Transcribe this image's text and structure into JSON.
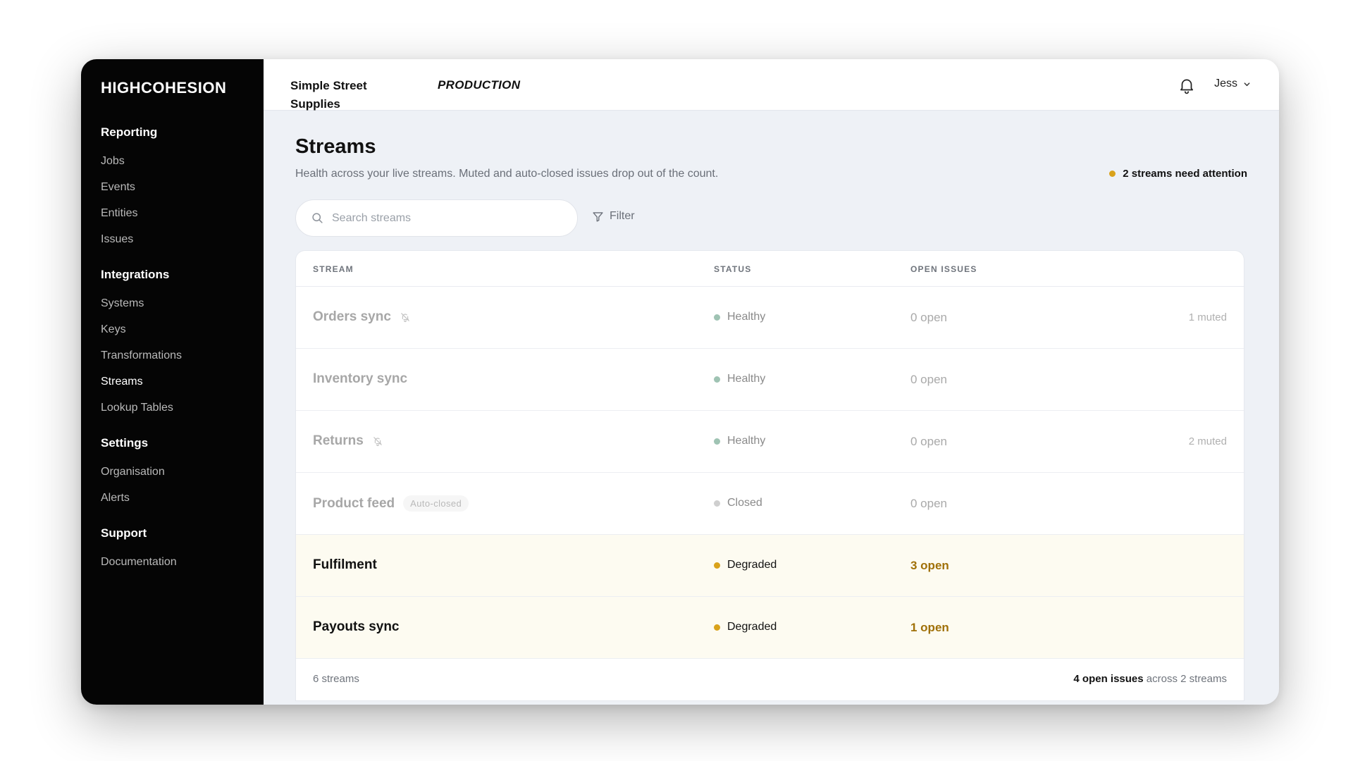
{
  "sidebar": {
    "logo": "HIGHCOHESION",
    "groups": [
      {
        "heading": "Reporting",
        "items": [
          "Jobs",
          "Events",
          "Entities",
          "Issues"
        ]
      },
      {
        "heading": "Integrations",
        "items": [
          "Systems",
          "Keys",
          "Transformations",
          "Streams",
          "Lookup Tables"
        ]
      },
      {
        "heading": "Settings",
        "items": [
          "Organisation",
          "Alerts"
        ]
      },
      {
        "heading": "Support",
        "items": [
          "Documentation"
        ]
      }
    ],
    "active_item": "Streams"
  },
  "topbar": {
    "org_name": "Simple Street Supplies",
    "environment": "PRODUCTION",
    "user_name": "Jess"
  },
  "page": {
    "title": "Streams",
    "subtitle": "Health across your live streams. Muted and auto-closed issues drop out of the count.",
    "attention": "2 streams need attention"
  },
  "search": {
    "placeholder": "Search streams"
  },
  "filter_label": "Filter",
  "table": {
    "columns": [
      "STREAM",
      "STATUS",
      "OPEN ISSUES"
    ],
    "rows": [
      {
        "name": "Orders sync",
        "muted_icon": true,
        "tag": "",
        "status": "Healthy",
        "issues": "0 open",
        "muted": "1 muted",
        "state": "healthy"
      },
      {
        "name": "Inventory sync",
        "muted_icon": false,
        "tag": "",
        "status": "Healthy",
        "issues": "0 open",
        "muted": "",
        "state": "healthy"
      },
      {
        "name": "Returns",
        "muted_icon": true,
        "tag": "",
        "status": "Healthy",
        "issues": "0 open",
        "muted": "2 muted",
        "state": "healthy"
      },
      {
        "name": "Product feed",
        "muted_icon": false,
        "tag": "Auto-closed",
        "status": "Closed",
        "issues": "0 open",
        "muted": "",
        "state": "closed"
      },
      {
        "name": "Fulfilment",
        "muted_icon": false,
        "tag": "",
        "status": "Degraded",
        "issues": "3 open",
        "muted": "",
        "state": "degraded"
      },
      {
        "name": "Payouts sync",
        "muted_icon": false,
        "tag": "",
        "status": "Degraded",
        "issues": "1 open",
        "muted": "",
        "state": "degraded"
      }
    ],
    "footer_count": "6 streams",
    "footer_summary_bold": "4 open issues",
    "footer_summary_rest": " across 2 streams"
  },
  "colors": {
    "sidebar_bg": "#050505",
    "degraded": "#d9a21b",
    "healthy": "#9fc3b3",
    "closed": "#cfcfcf",
    "degraded_row_bg": "#fdfbf1"
  },
  "icons": {
    "search": "search-icon",
    "filter": "filter-icon",
    "bell": "bell-icon",
    "chevron": "chevron-down-icon",
    "muted": "bell-off-icon"
  }
}
